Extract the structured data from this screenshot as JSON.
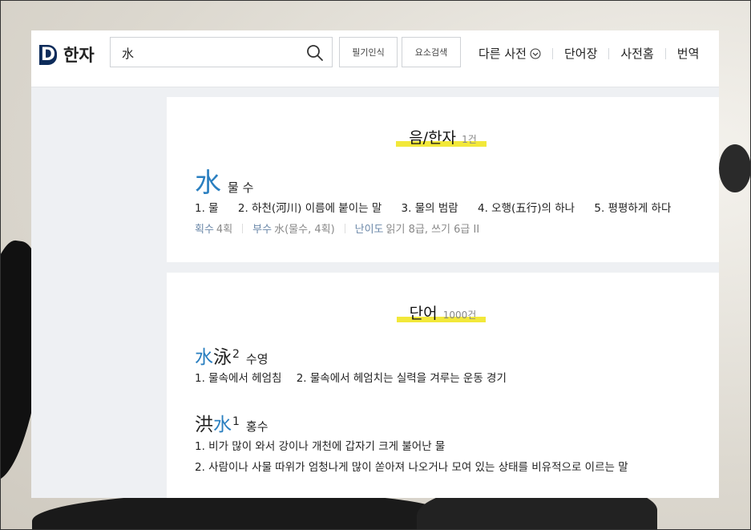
{
  "header": {
    "logo_letter": "D",
    "logo_text": "한자",
    "search_value": "水",
    "handwriting_button": "필기인식",
    "component_search_button": "요소검색",
    "nav": [
      "다른 사전",
      "단어장",
      "사전홈",
      "번역"
    ]
  },
  "hanja_section": {
    "title": "음/한자",
    "count": "1건",
    "char": "水",
    "reading": "물 수",
    "meanings": [
      "1. 물",
      "2. 하천(河川) 이름에 붙이는 말",
      "3. 물의 범람",
      "4. 오행(五行)의 하나",
      "5. 평평하게 하다"
    ],
    "strokes_label": "획수",
    "strokes_value": "4획",
    "radical_label": "부수",
    "radical_value": "水(물수, 4획)",
    "level_label": "난이도",
    "level_value": "읽기 8급, 쓰기 6급 II"
  },
  "word_section": {
    "title": "단어",
    "count": "1000건",
    "words": [
      {
        "char1": "水",
        "char2": "泳",
        "sup": "2",
        "reading": "수영",
        "defs": [
          "1. 물속에서 헤엄침",
          "2. 물속에서 헤엄치는 실력을 겨루는 운동 경기"
        ]
      },
      {
        "char1": "洪",
        "char2": "水",
        "sup": "1",
        "reading": "홍수",
        "defs": [
          "1. 비가 많이 와서 강이나 개천에 갑자기 크게 불어난 물",
          "2. 사람이나 사물 따위가 엄청나게 많이 쏟아져 나오거나 모여 있는 상태를 비유적으로 이르는 말"
        ]
      }
    ]
  },
  "colors": {
    "accent_blue": "#2a7fc0",
    "highlight_yellow": "#f2e83a",
    "logo_navy": "#0d2b5a"
  }
}
